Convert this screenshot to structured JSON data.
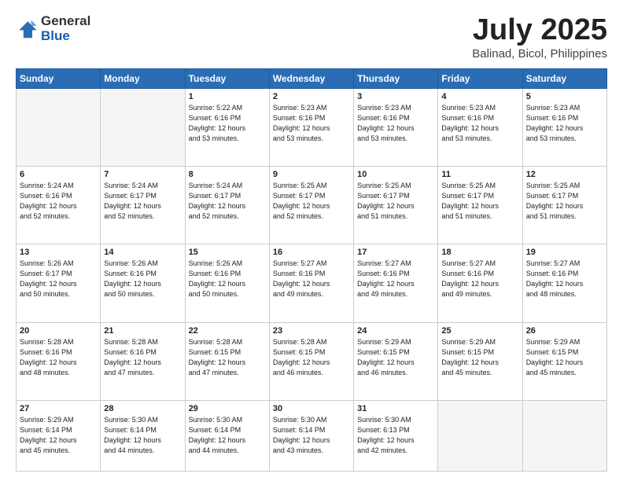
{
  "logo": {
    "general": "General",
    "blue": "Blue"
  },
  "header": {
    "title": "July 2025",
    "subtitle": "Balinad, Bicol, Philippines"
  },
  "weekdays": [
    "Sunday",
    "Monday",
    "Tuesday",
    "Wednesday",
    "Thursday",
    "Friday",
    "Saturday"
  ],
  "weeks": [
    [
      {
        "day": "",
        "info": ""
      },
      {
        "day": "",
        "info": ""
      },
      {
        "day": "1",
        "info": "Sunrise: 5:22 AM\nSunset: 6:16 PM\nDaylight: 12 hours\nand 53 minutes."
      },
      {
        "day": "2",
        "info": "Sunrise: 5:23 AM\nSunset: 6:16 PM\nDaylight: 12 hours\nand 53 minutes."
      },
      {
        "day": "3",
        "info": "Sunrise: 5:23 AM\nSunset: 6:16 PM\nDaylight: 12 hours\nand 53 minutes."
      },
      {
        "day": "4",
        "info": "Sunrise: 5:23 AM\nSunset: 6:16 PM\nDaylight: 12 hours\nand 53 minutes."
      },
      {
        "day": "5",
        "info": "Sunrise: 5:23 AM\nSunset: 6:16 PM\nDaylight: 12 hours\nand 53 minutes."
      }
    ],
    [
      {
        "day": "6",
        "info": "Sunrise: 5:24 AM\nSunset: 6:16 PM\nDaylight: 12 hours\nand 52 minutes."
      },
      {
        "day": "7",
        "info": "Sunrise: 5:24 AM\nSunset: 6:17 PM\nDaylight: 12 hours\nand 52 minutes."
      },
      {
        "day": "8",
        "info": "Sunrise: 5:24 AM\nSunset: 6:17 PM\nDaylight: 12 hours\nand 52 minutes."
      },
      {
        "day": "9",
        "info": "Sunrise: 5:25 AM\nSunset: 6:17 PM\nDaylight: 12 hours\nand 52 minutes."
      },
      {
        "day": "10",
        "info": "Sunrise: 5:25 AM\nSunset: 6:17 PM\nDaylight: 12 hours\nand 51 minutes."
      },
      {
        "day": "11",
        "info": "Sunrise: 5:25 AM\nSunset: 6:17 PM\nDaylight: 12 hours\nand 51 minutes."
      },
      {
        "day": "12",
        "info": "Sunrise: 5:25 AM\nSunset: 6:17 PM\nDaylight: 12 hours\nand 51 minutes."
      }
    ],
    [
      {
        "day": "13",
        "info": "Sunrise: 5:26 AM\nSunset: 6:17 PM\nDaylight: 12 hours\nand 50 minutes."
      },
      {
        "day": "14",
        "info": "Sunrise: 5:26 AM\nSunset: 6:16 PM\nDaylight: 12 hours\nand 50 minutes."
      },
      {
        "day": "15",
        "info": "Sunrise: 5:26 AM\nSunset: 6:16 PM\nDaylight: 12 hours\nand 50 minutes."
      },
      {
        "day": "16",
        "info": "Sunrise: 5:27 AM\nSunset: 6:16 PM\nDaylight: 12 hours\nand 49 minutes."
      },
      {
        "day": "17",
        "info": "Sunrise: 5:27 AM\nSunset: 6:16 PM\nDaylight: 12 hours\nand 49 minutes."
      },
      {
        "day": "18",
        "info": "Sunrise: 5:27 AM\nSunset: 6:16 PM\nDaylight: 12 hours\nand 49 minutes."
      },
      {
        "day": "19",
        "info": "Sunrise: 5:27 AM\nSunset: 6:16 PM\nDaylight: 12 hours\nand 48 minutes."
      }
    ],
    [
      {
        "day": "20",
        "info": "Sunrise: 5:28 AM\nSunset: 6:16 PM\nDaylight: 12 hours\nand 48 minutes."
      },
      {
        "day": "21",
        "info": "Sunrise: 5:28 AM\nSunset: 6:16 PM\nDaylight: 12 hours\nand 47 minutes."
      },
      {
        "day": "22",
        "info": "Sunrise: 5:28 AM\nSunset: 6:15 PM\nDaylight: 12 hours\nand 47 minutes."
      },
      {
        "day": "23",
        "info": "Sunrise: 5:28 AM\nSunset: 6:15 PM\nDaylight: 12 hours\nand 46 minutes."
      },
      {
        "day": "24",
        "info": "Sunrise: 5:29 AM\nSunset: 6:15 PM\nDaylight: 12 hours\nand 46 minutes."
      },
      {
        "day": "25",
        "info": "Sunrise: 5:29 AM\nSunset: 6:15 PM\nDaylight: 12 hours\nand 45 minutes."
      },
      {
        "day": "26",
        "info": "Sunrise: 5:29 AM\nSunset: 6:15 PM\nDaylight: 12 hours\nand 45 minutes."
      }
    ],
    [
      {
        "day": "27",
        "info": "Sunrise: 5:29 AM\nSunset: 6:14 PM\nDaylight: 12 hours\nand 45 minutes."
      },
      {
        "day": "28",
        "info": "Sunrise: 5:30 AM\nSunset: 6:14 PM\nDaylight: 12 hours\nand 44 minutes."
      },
      {
        "day": "29",
        "info": "Sunrise: 5:30 AM\nSunset: 6:14 PM\nDaylight: 12 hours\nand 44 minutes."
      },
      {
        "day": "30",
        "info": "Sunrise: 5:30 AM\nSunset: 6:14 PM\nDaylight: 12 hours\nand 43 minutes."
      },
      {
        "day": "31",
        "info": "Sunrise: 5:30 AM\nSunset: 6:13 PM\nDaylight: 12 hours\nand 42 minutes."
      },
      {
        "day": "",
        "info": ""
      },
      {
        "day": "",
        "info": ""
      }
    ]
  ]
}
